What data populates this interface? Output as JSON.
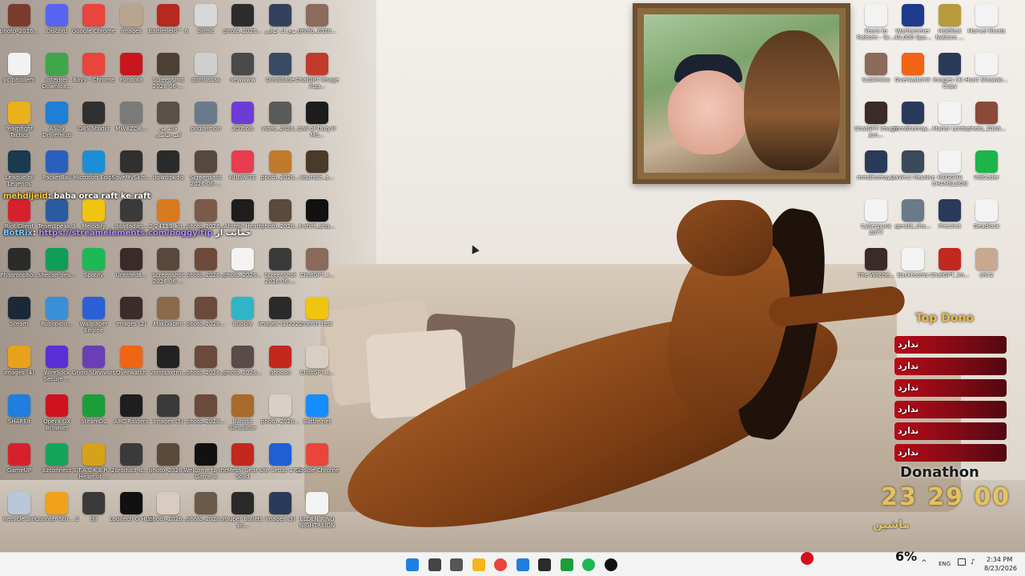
{
  "desktop": {
    "icons": [
      {
        "label": "photo_2026...",
        "color": "#7a3b2e"
      },
      {
        "label": "Discord",
        "color": "#5865f2"
      },
      {
        "label": "Google Chrome",
        "color": "#e8453c"
      },
      {
        "label": "images",
        "color": "#b9a48f"
      },
      {
        "label": "Battlefield™ 6",
        "color": "#b7281e"
      },
      {
        "label": "djimic",
        "color": "#d8d8d8"
      },
      {
        "label": "photo_2026...",
        "color": "#2c2c2c"
      },
      {
        "label": "بوی لد خوابی",
        "color": "#33415f"
      },
      {
        "label": "photo_2026...",
        "color": "#8a6b5c"
      },
      {
        "label": "pc problem",
        "color": "#f2f2f2"
      },
      {
        "label": "Internet Downloa...",
        "color": "#3da74a"
      },
      {
        "label": "Bayy - Chrome",
        "color": "#e8453c"
      },
      {
        "label": "Fundota",
        "color": "#c9151e"
      },
      {
        "label": "Screenshot 2026-06-...",
        "color": "#4c4034"
      },
      {
        "label": "djimicssss",
        "color": "#cfcfcf"
      },
      {
        "label": "newwww",
        "color": "#4a4a4a"
      },
      {
        "label": "Dinoblade",
        "color": "#3a4a63"
      },
      {
        "label": "ChatGPT Image Aug...",
        "color": "#c23a2c"
      },
      {
        "label": "Teamfight Tactics",
        "color": "#e9b21a"
      },
      {
        "label": "ASUS DriverHub",
        "color": "#1d7fd6"
      },
      {
        "label": "OBS Studio",
        "color": "#303030"
      },
      {
        "label": "MWBZDB...",
        "color": "#7a7a7a"
      },
      {
        "label": "خانه من امیرعباسی",
        "color": "#5a5048"
      },
      {
        "label": "pngdemon",
        "color": "#6a7a8c"
      },
      {
        "label": "3DTools",
        "color": "#6d3cd6"
      },
      {
        "label": "video_2026...",
        "color": "#5a5a5a"
      },
      {
        "label": "Call of Duty® Mo...",
        "color": "#1c1c1c"
      },
      {
        "label": "League of Legends",
        "color": "#1a3a4f"
      },
      {
        "label": "PacketBall",
        "color": "#2a5fbd"
      },
      {
        "label": "Microsoft Edge",
        "color": "#1b8fd6"
      },
      {
        "label": "SaveMySkin...",
        "color": "#303030"
      },
      {
        "label": "dqwdqwdq",
        "color": "#2b2b2b"
      },
      {
        "label": "Screenshot 2026-06-...",
        "color": "#56493c"
      },
      {
        "label": "RUBINITE",
        "color": "#e83c4f"
      },
      {
        "label": "photo_2026...",
        "color": "#c07a2c"
      },
      {
        "label": "kourosh_a...",
        "color": "#4a3a2a"
      },
      {
        "label": "Riot Client",
        "color": "#d6212d"
      },
      {
        "label": "TeamSpeak 3",
        "color": "#2a5aa0"
      },
      {
        "label": "Melodify",
        "color": "#f1c40f"
      },
      {
        "label": "ddadadan...",
        "color": "#3a3a3a"
      },
      {
        "label": "2-24113_kn...",
        "color": "#d97a1e"
      },
      {
        "label": "photo_2026...",
        "color": "#7a5a48"
      },
      {
        "label": "Atomic Heart",
        "color": "#1e1e1e"
      },
      {
        "label": "photo_2026...",
        "color": "#5a4a3c"
      },
      {
        "label": "t-shirt_png...",
        "color": "#111111"
      },
      {
        "label": "Phasmopho...",
        "color": "#2b2b2b"
      },
      {
        "label": "shecan-des...",
        "color": "#0f9d58"
      },
      {
        "label": "Spotify",
        "color": "#1db954"
      },
      {
        "label": "Untitled8...",
        "color": "#3a2a2a"
      },
      {
        "label": "Screenshot 2026-06-...",
        "color": "#57483b"
      },
      {
        "label": "photo_2026...",
        "color": "#6b4a3a"
      },
      {
        "label": "photo_2026...",
        "color": "#f3f3f3"
      },
      {
        "label": "Screenshot 2026-06-...",
        "color": "#3a3a3a"
      },
      {
        "label": "ChatGPT_I...",
        "color": "#8a6a5a"
      },
      {
        "label": "Steam",
        "color": "#1b2838"
      },
      {
        "label": "Roboping...",
        "color": "#3b8fd6"
      },
      {
        "label": "Wallpaper Engine",
        "color": "#2b5fd6"
      },
      {
        "label": "images (2)",
        "color": "#3b2b2b"
      },
      {
        "label": "MakGaben",
        "color": "#8a6a4a"
      },
      {
        "label": "photo_2026...",
        "color": "#6a4a3a"
      },
      {
        "label": "Bubbly",
        "color": "#2fb5c8"
      },
      {
        "label": "images (1)2222",
        "color": "#2a2a2a"
      },
      {
        "label": "merch test",
        "color": "#f1c40f"
      },
      {
        "label": "images (4)",
        "color": "#e8a21a"
      },
      {
        "label": "WireSock Secure ...",
        "color": "#5a2fd6"
      },
      {
        "label": "Grind Survivors",
        "color": "#6a3fb5"
      },
      {
        "label": "Overwatch",
        "color": "#f06414"
      },
      {
        "label": "vongsaxtm...",
        "color": "#222222"
      },
      {
        "label": "photo_2026...",
        "color": "#6a4a3a"
      },
      {
        "label": "photo_2026...",
        "color": "#5a4a4a"
      },
      {
        "label": "ghoooo",
        "color": "#c2281e"
      },
      {
        "label": "ChatGPT_I...",
        "color": "#d8cfc4"
      },
      {
        "label": "SHAREit",
        "color": "#1e7fe0"
      },
      {
        "label": "Opera GX Browser",
        "color": "#d0121e"
      },
      {
        "label": "SteamDL",
        "color": "#1b9e3a"
      },
      {
        "label": "ARC Raiders",
        "color": "#1e1e1e"
      },
      {
        "label": "images (5)",
        "color": "#3a3a3a"
      },
      {
        "label": "photo_2026...",
        "color": "#6a4a3a"
      },
      {
        "label": "Barista Simulator",
        "color": "#a86a2a"
      },
      {
        "label": "photo_2026...",
        "color": "#d8d0c8"
      },
      {
        "label": "Battle.net",
        "color": "#148eff"
      },
      {
        "label": "GameUP",
        "color": "#d6212d"
      },
      {
        "label": "Ezconnect",
        "color": "#16a35a"
      },
      {
        "label": "S.T.A.L.K.E.R. 2 Heart of ...",
        "color": "#d6a21a"
      },
      {
        "label": "product_d...",
        "color": "#3a3a3a"
      },
      {
        "label": "photo_2026...",
        "color": "#5a4a3a"
      },
      {
        "label": "Welcome to the Game II",
        "color": "#111111"
      },
      {
        "label": "Metal Gear Solid",
        "color": "#c2281e"
      },
      {
        "label": "sXe Setup 17.2",
        "color": "#1e5fd6"
      },
      {
        "label": "Google Chrome",
        "color": "#e8453c"
      },
      {
        "label": "Recycle Bin",
        "color": "#b9c8d8"
      },
      {
        "label": "Counter-Stri... 2",
        "color": "#f0a21a"
      },
      {
        "label": "dji",
        "color": "#3a3a3a"
      },
      {
        "label": "Logitech G HUB",
        "color": "#111111"
      },
      {
        "label": "photo_2026...",
        "color": "#d8ccc0"
      },
      {
        "label": "photo_2026...",
        "color": "#6a5a4a"
      },
      {
        "label": "Pauper Bullets an...",
        "color": "#2a2a2a"
      },
      {
        "label": "images (3)",
        "color": "#2a3a5a"
      },
      {
        "label": "ELDEN RING NIGHTREIGN",
        "color": "#f3f3f3"
      },
      {
        "label": "Fears to Fathom - Sc...",
        "color": "#f3f3f3"
      },
      {
        "label": "Warhammer 40,000 Spa...",
        "color": "#1e3a8a"
      },
      {
        "label": "Holdfast Nations ...",
        "color": "#b89a3a"
      },
      {
        "label": "Marvel Rivals",
        "color": "#f3f3f3"
      },
      {
        "label": "Sublimino",
        "color": "#8a6a5a"
      },
      {
        "label": "Overwatch®",
        "color": "#f06414"
      },
      {
        "label": "images (3) - Copy",
        "color": "#2a3a5a"
      },
      {
        "label": "Hunt Showdo...",
        "color": "#f3f3f3"
      },
      {
        "label": "ChatGPT Image Jun...",
        "color": "#3a2a2a"
      },
      {
        "label": "mmdhomay...",
        "color": "#2a3a5a"
      },
      {
        "label": "Manor Lords",
        "color": "#f3f3f3"
      },
      {
        "label": "photo_2026...",
        "color": "#8a4a3a"
      },
      {
        "label": "mmdhomay...",
        "color": "#2a3a5a"
      },
      {
        "label": "DaVinci Resolve",
        "color": "#3a4a5a"
      },
      {
        "label": "MEGGHA CHAMELEON",
        "color": "#f3f3f3"
      },
      {
        "label": "VidCoder",
        "color": "#1bb54a"
      },
      {
        "label": "Cyberpunk 2077",
        "color": "#f3f3f3"
      },
      {
        "label": "gerald_cha...",
        "color": "#6a7a8a"
      },
      {
        "label": "Precinct",
        "color": "#2a3a5a"
      },
      {
        "label": "Deadlock",
        "color": "#f3f3f3"
      },
      {
        "label": "The Witche...",
        "color": "#3a2a2a"
      },
      {
        "label": "Backrooms",
        "color": "#f3f3f3"
      },
      {
        "label": "ChatGPT_Im...",
        "color": "#c2281e"
      },
      {
        "label": "shir2",
        "color": "#c8a890"
      }
    ]
  },
  "chat": {
    "line1_user": "mehdijeid",
    "line1_text": ": baba orca raft ke raft",
    "line2_user": "BotRix",
    "line2_text": ": ",
    "line2_link": "https://streamelements.com/boggy/tip",
    "line2_suffix": " حمایت از"
  },
  "donations": {
    "title": "Top Dono",
    "rows": [
      "ندارد",
      "ندارد",
      "ندارد",
      "ندارد",
      "ندارد",
      "ندارد"
    ],
    "donathon_label": "Donathon",
    "timer": "23 29 00",
    "timer_sub": "ماشین"
  },
  "taskbar": {
    "language": "ENG",
    "time": "2:34 PM",
    "date": "8/23/2026",
    "volume": "6%",
    "apps": [
      {
        "name": "start-button",
        "color": "#1e7fe0"
      },
      {
        "name": "search-button",
        "color": "#444444"
      },
      {
        "name": "task-view-button",
        "color": "#555555"
      },
      {
        "name": "file-explorer-button",
        "color": "#f2b81a"
      },
      {
        "name": "chrome-button",
        "color": "#e8453c"
      },
      {
        "name": "vscode-button",
        "color": "#1e7fe0"
      },
      {
        "name": "obs-button",
        "color": "#2b2b2b"
      },
      {
        "name": "steamdl-button",
        "color": "#1b9e3a"
      },
      {
        "name": "spotify-button",
        "color": "#1db954"
      },
      {
        "name": "logitech-button",
        "color": "#111111"
      }
    ]
  }
}
